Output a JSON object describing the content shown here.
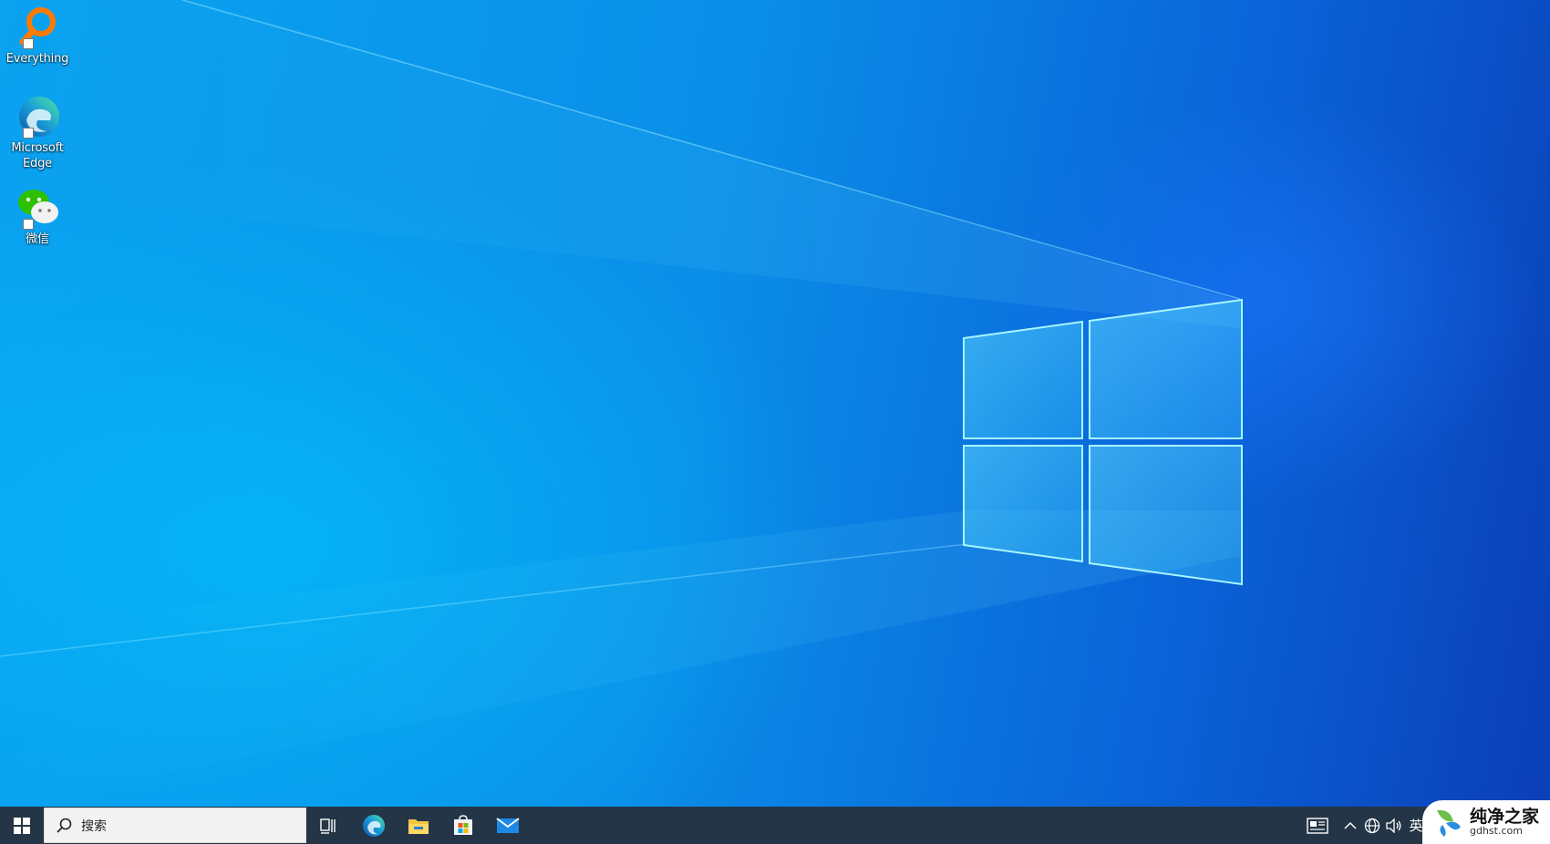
{
  "desktop": {
    "icons": [
      {
        "label": "Everything",
        "icon": "everything-search-icon"
      },
      {
        "label": "Microsoft Edge",
        "icon": "edge-icon"
      },
      {
        "label": "微信",
        "icon": "wechat-icon"
      }
    ]
  },
  "taskbar": {
    "search": {
      "placeholder": "搜索"
    },
    "pinned": [
      "task-view-icon",
      "edge-icon",
      "file-explorer-icon",
      "microsoft-store-icon",
      "mail-icon"
    ],
    "tray": {
      "ime_label": "英"
    }
  },
  "watermark": {
    "title": "纯净之家",
    "subtitle": "gdhst.com"
  },
  "colors": {
    "taskbar": "#233546",
    "wallpaper_accent": "#0a8ee8"
  }
}
